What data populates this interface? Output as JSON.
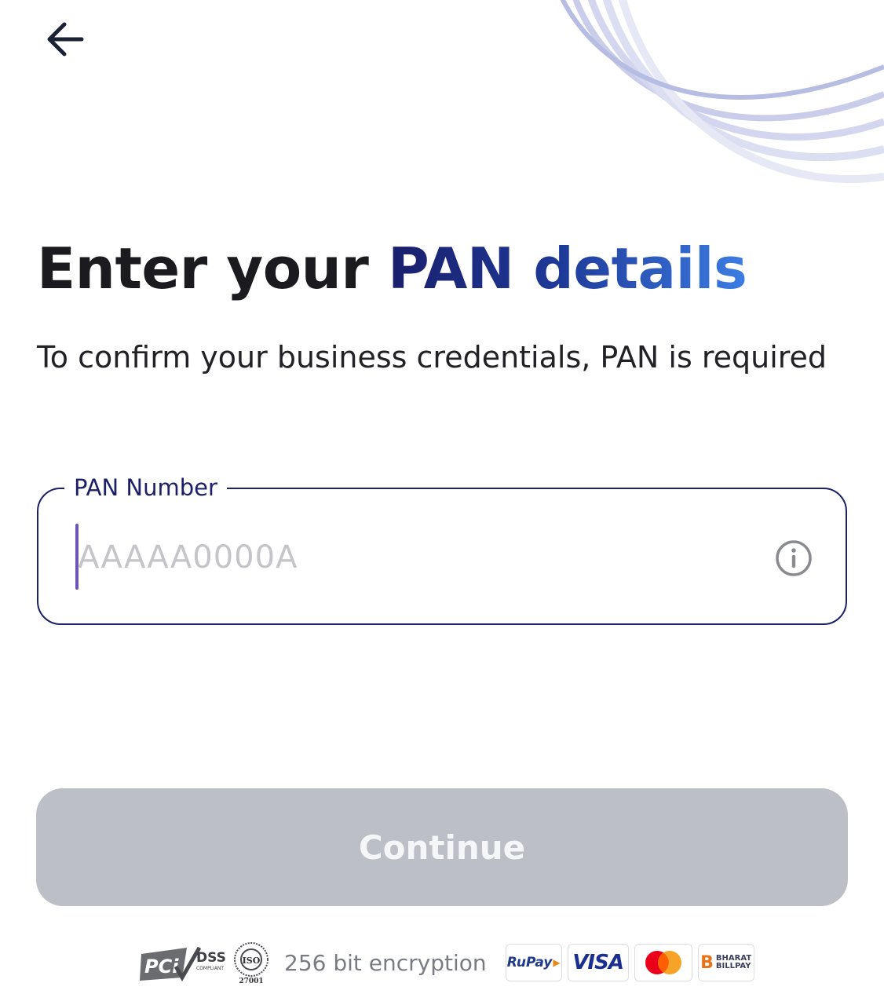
{
  "header": {
    "back_icon": "arrow-left-icon"
  },
  "title": {
    "part1": "Enter your ",
    "part2": "PAN details"
  },
  "subtitle": "To confirm your business credentials, PAN is required",
  "pan_field": {
    "label": "PAN Number",
    "placeholder": "AAAAA0000A",
    "value": "",
    "info_icon": "info-circle-icon"
  },
  "continue_button": {
    "label": "Continue",
    "enabled": false
  },
  "footer": {
    "pci_text": "PCi",
    "dss_text": "DSS",
    "dss_sub": "COMPLIANT",
    "iso_text": "ISO",
    "iso_number": "27001",
    "encryption_text": "256 bit encryption",
    "rupay_text": "RuPay",
    "visa_text": "VISA",
    "bbps_letter": "B",
    "bbps_line1": "BHARAT",
    "bbps_line2": "BILLPAY"
  },
  "colors": {
    "accent_dark": "#1c2068",
    "accent_gradient_end": "#3d7de3",
    "button_disabled": "#bcbfc6",
    "caret": "#6a55b8"
  }
}
